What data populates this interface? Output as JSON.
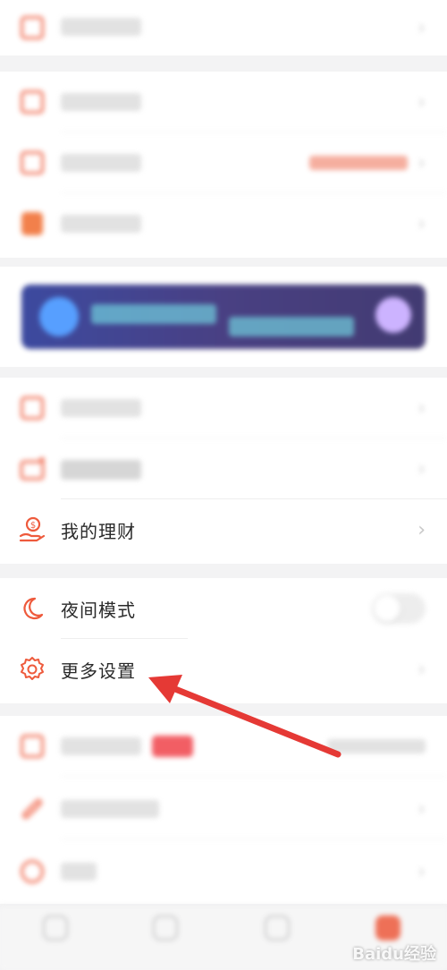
{
  "rows": {
    "wealth": {
      "label": "我的理财"
    },
    "night_mode": {
      "label": "夜间模式"
    },
    "more_settings": {
      "label": "更多设置"
    }
  },
  "icons": {
    "wealth": "wealth-hand-icon",
    "night_mode": "moon-icon",
    "more_settings": "gear-icon"
  },
  "colors": {
    "accent": "#ee5a3c",
    "arrow": "#e53935"
  },
  "watermark": "Baidu经验"
}
